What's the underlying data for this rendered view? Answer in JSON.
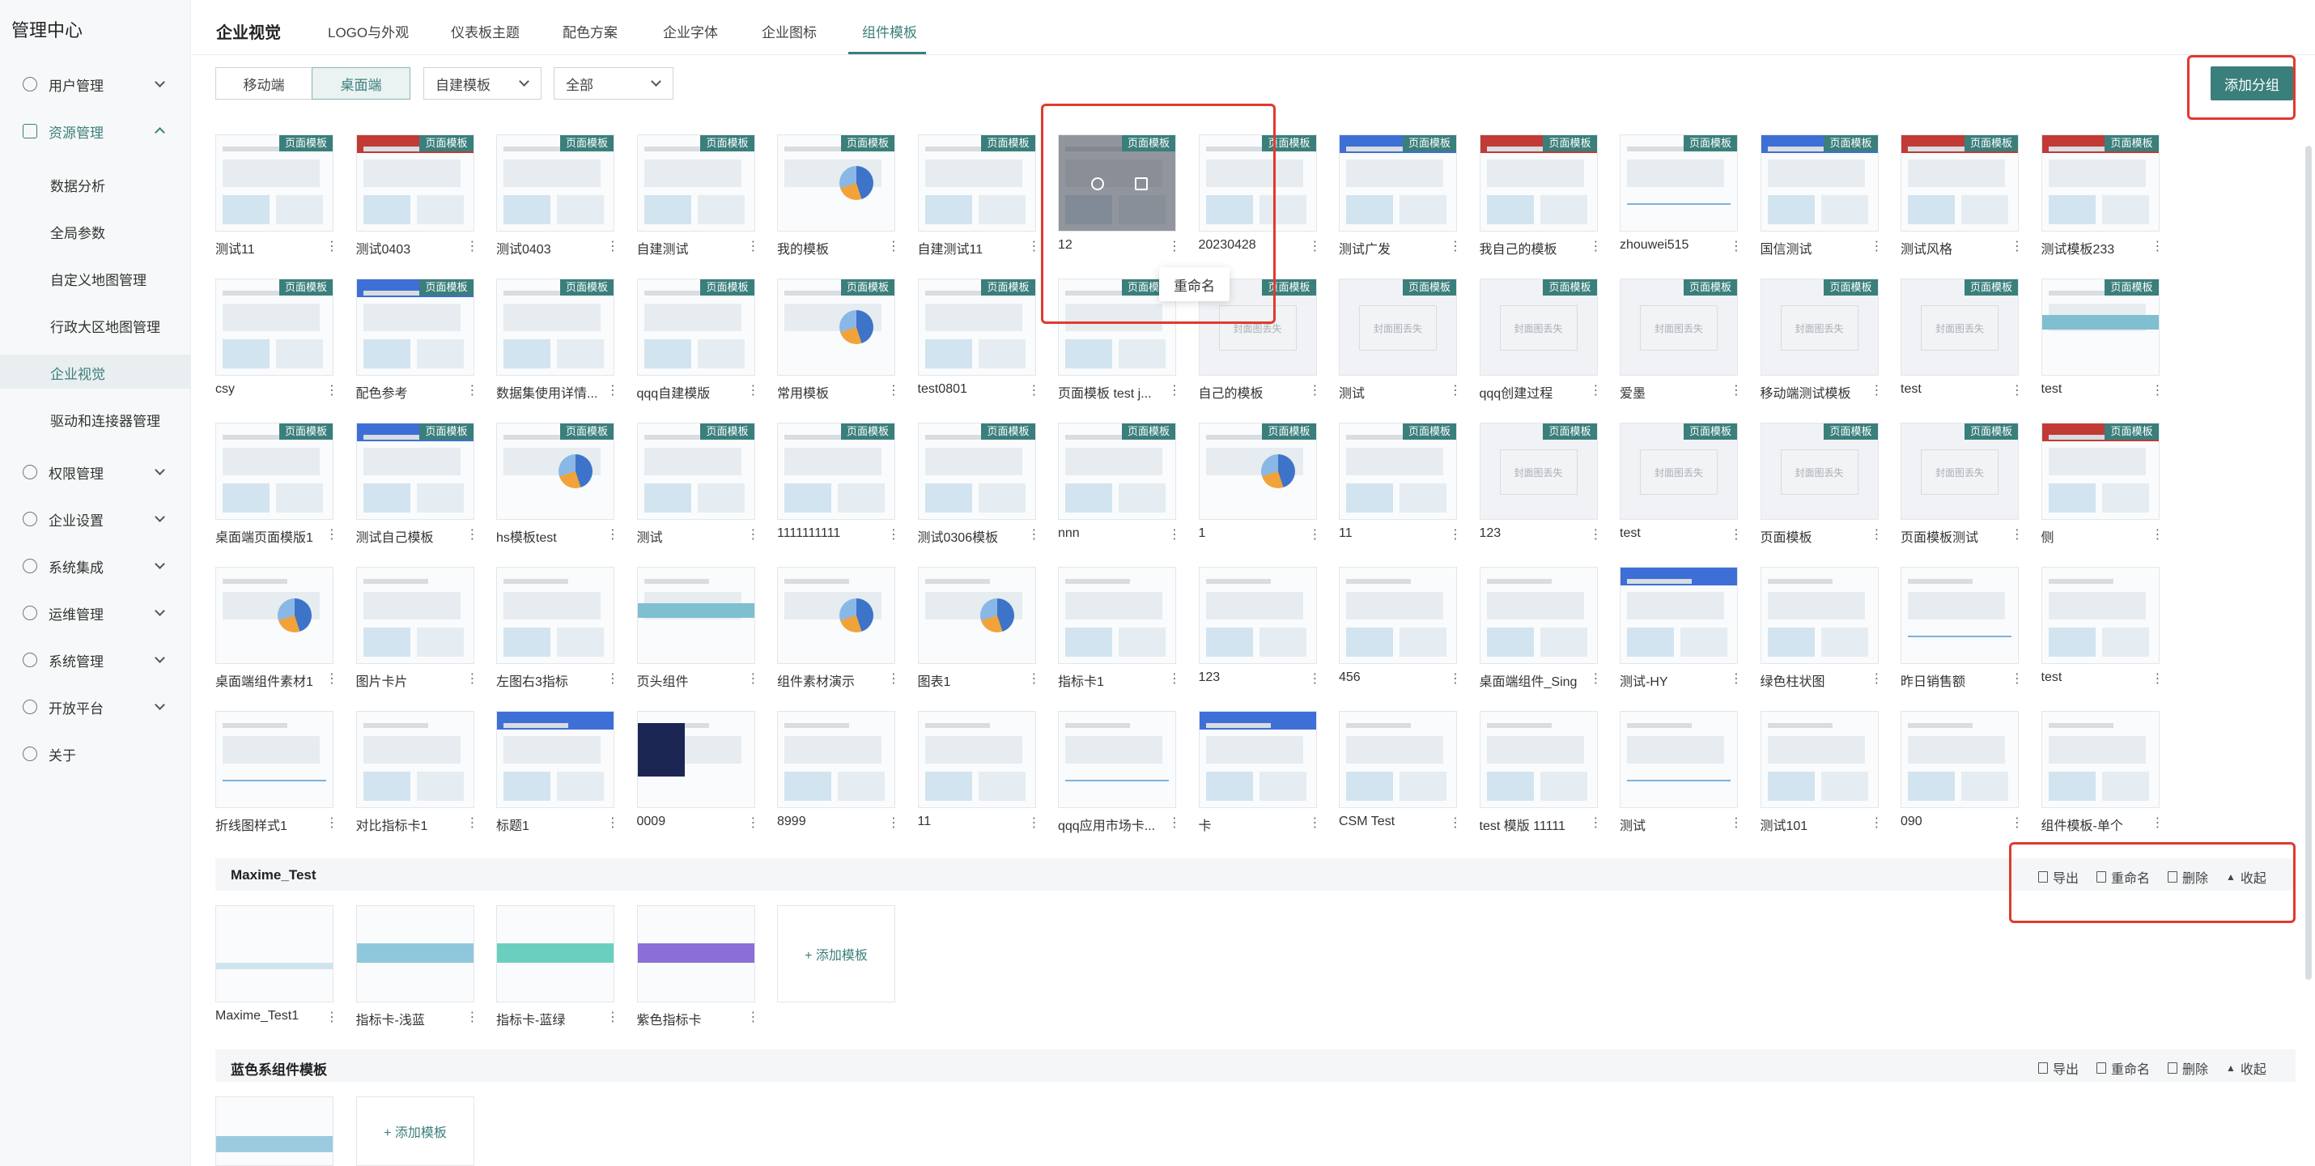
{
  "sidebar": {
    "title": "管理中心",
    "menu": [
      {
        "label": "用户管理",
        "icon": "user-icon"
      },
      {
        "label": "资源管理",
        "icon": "grid-icon"
      },
      {
        "label": "权限管理",
        "icon": "shield-icon"
      },
      {
        "label": "企业设置",
        "icon": "building-icon"
      },
      {
        "label": "系统集成",
        "icon": "integration-icon"
      },
      {
        "label": "运维管理",
        "icon": "monitor-icon"
      },
      {
        "label": "系统管理",
        "icon": "settings-icon"
      },
      {
        "label": "开放平台",
        "icon": "platform-icon"
      },
      {
        "label": "关于",
        "icon": "info-icon"
      }
    ],
    "submenu": [
      "数据分析",
      "全局参数",
      "自定义地图管理",
      "行政大区地图管理",
      "企业视觉",
      "驱动和连接器管理"
    ]
  },
  "topbar": {
    "brand": "企业视觉",
    "tabs": [
      "LOGO与外观",
      "仪表板主题",
      "配色方案",
      "企业字体",
      "企业图标",
      "组件模板"
    ]
  },
  "filters": {
    "mobile": "移动端",
    "desktop": "桌面端",
    "custom_template": "自建模板",
    "all": "全部",
    "add_group": "添加分组"
  },
  "badge_text": "页面模板",
  "missing_text": "封面图丢失",
  "rename_label": "重命名",
  "templates": [
    "测试11",
    "测试0403",
    "测试0403",
    "自建测试",
    "我的模板",
    "自建测试11",
    "12",
    "20230428",
    "测试广发",
    "我自己的模板",
    "zhouwei515",
    "国信测试",
    "测试风格",
    "测试模板233",
    "csy",
    "配色参考",
    "数据集使用详情...",
    "qqq自建模版",
    "常用模板",
    "test0801",
    "页面模板 test j...",
    "自己的模板",
    "测试",
    "qqq创建过程",
    "爱墨",
    "移动端测试模板",
    "test",
    "test",
    "桌面端页面模版1",
    "测试自己模板",
    "hs模板test",
    "测试",
    "1111111111",
    "测试0306模板",
    "nnn",
    "1",
    "11",
    "123",
    "test",
    "页面模板",
    "页面模板测试",
    "侧",
    "桌面端组件素材1",
    "图片卡片",
    "左图右3指标",
    "页头组件",
    "组件素材演示",
    "图表1",
    "指标卡1",
    "123",
    "456",
    "桌面端组件_Sing",
    "测试-HY",
    "绿色柱状图",
    "昨日销售额",
    "test",
    "折线图样式1",
    "对比指标卡1",
    "标题1",
    "0009",
    "8999",
    "11",
    "qqq应用市场卡...",
    "卡",
    "CSM Test",
    "test 模版 11111",
    "测试",
    "测试101",
    "090",
    "组件模板-单个"
  ],
  "group_actions": {
    "export": "导出",
    "rename": "重命名",
    "delete": "删除",
    "collapse": "收起"
  },
  "groups": [
    {
      "title": "Maxime_Test",
      "items": [
        "Maxime_Test1",
        "指标卡-浅蓝",
        "指标卡-蓝绿",
        "紫色指标卡"
      ]
    },
    {
      "title": "蓝色系组件模板",
      "items": [
        ""
      ]
    }
  ],
  "add_template": "+ 添加模板"
}
